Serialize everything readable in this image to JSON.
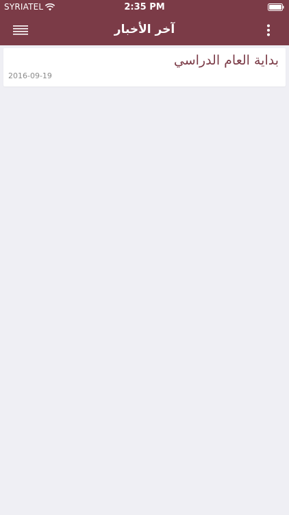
{
  "status_bar": {
    "carrier": "SYRIATEL",
    "time": "2:35 PM"
  },
  "navbar": {
    "title": "آخر الأخبار",
    "menu_icon": "hamburger-menu-icon",
    "more_icon": "vertical-dots-icon"
  },
  "news": [
    {
      "title": "بداية العام الدراسي",
      "date": "2016-09-19"
    }
  ],
  "colors": {
    "brand": "#7b3b47",
    "background": "#efeff4",
    "card": "#ffffff",
    "date_text": "#8a8a8a"
  }
}
